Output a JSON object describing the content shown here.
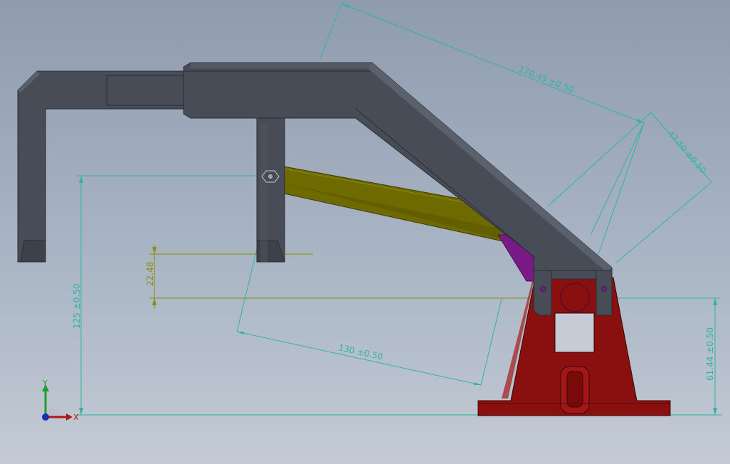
{
  "dimensions": {
    "d_170": "170.45 ±0.50",
    "d_47": "47.50 ±0.50",
    "d_130": "130 ±0.50",
    "d_125": "125 ±0.50",
    "d_22": "22.48",
    "d_61": "61.44 ±0.50"
  },
  "triad": {
    "x_label": "X",
    "y_label": "Y"
  },
  "colors": {
    "frame": "#474c56",
    "frame_light": "#5b616c",
    "link": "#6e6a00",
    "base": "#8a0f0f",
    "pivot": "#7a1a86",
    "dim_teal": "#2fb3a6",
    "dim_olive": "#8c8c00"
  }
}
